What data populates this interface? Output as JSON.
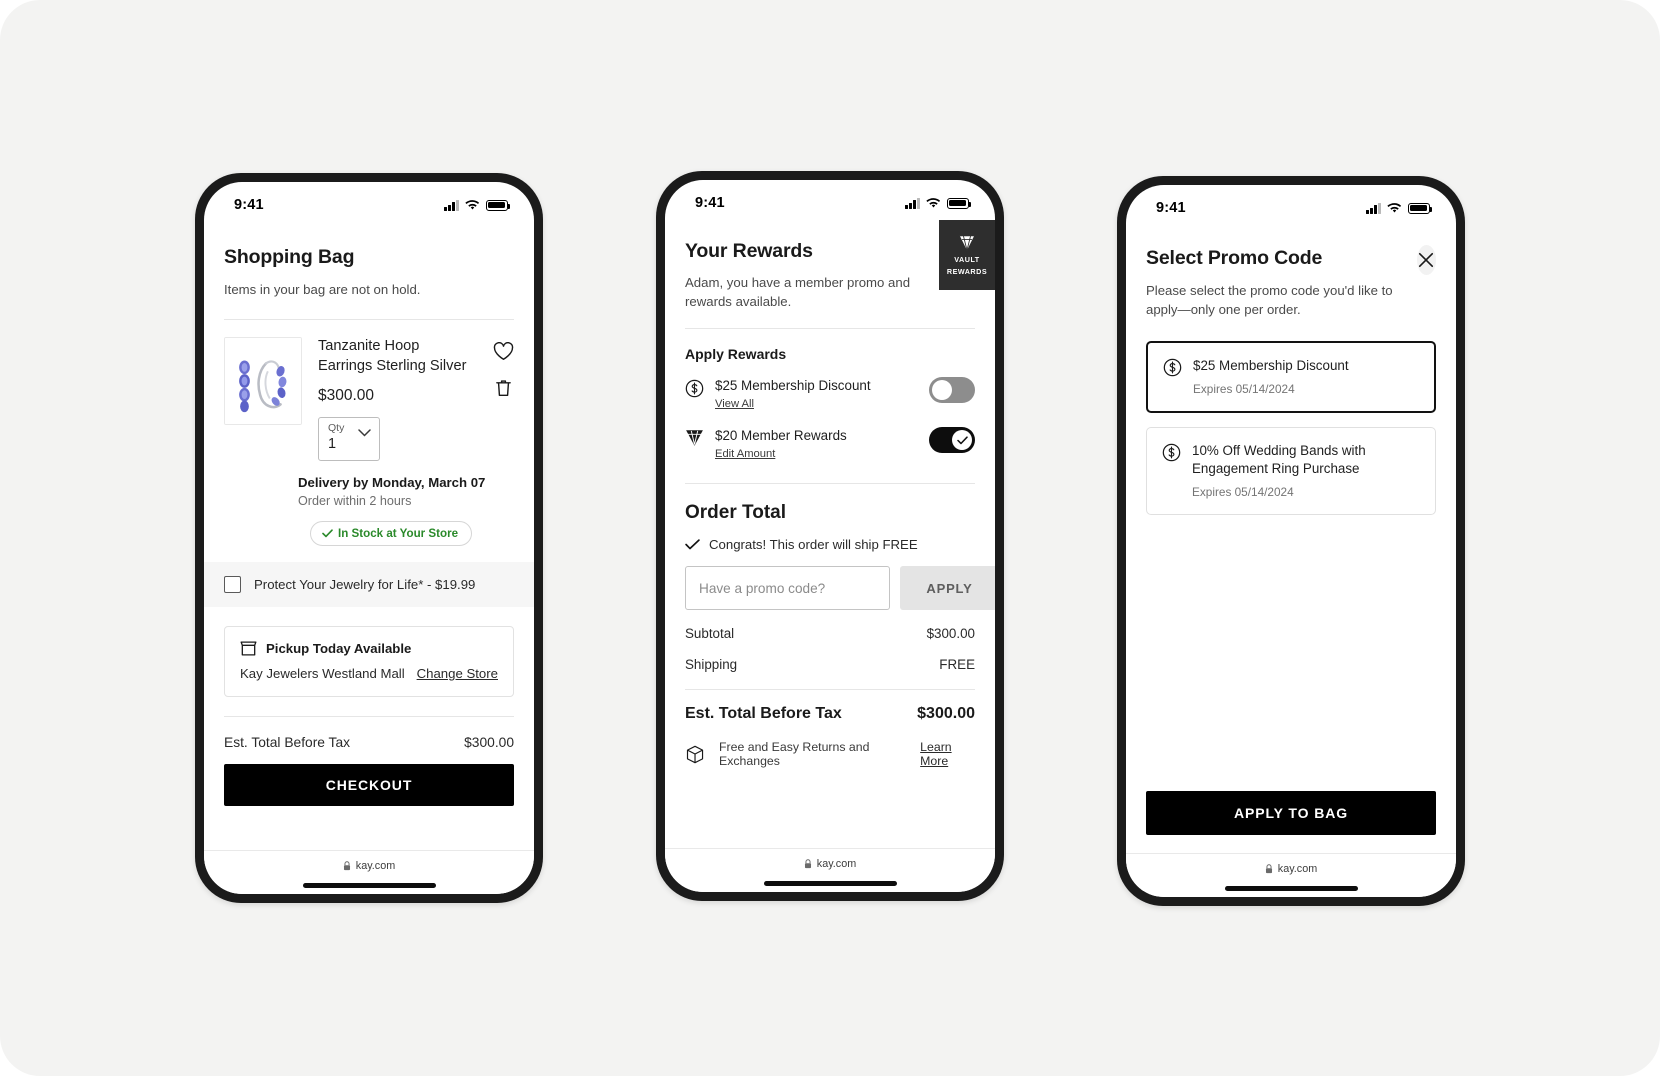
{
  "status_bar": {
    "time": "9:41",
    "signal_icon": "cellular-signal-icon",
    "wifi_icon": "wifi-icon",
    "battery_icon": "battery-icon"
  },
  "browser_footer": {
    "url": "kay.com",
    "lock_icon": "lock-icon"
  },
  "phone1": {
    "title": "Shopping Bag",
    "subtitle": "Items in your bag are not on hold.",
    "product": {
      "image_alt": "tanzanite-hoop-earrings-image",
      "title": "Tanzanite Hoop Earrings Sterling Silver",
      "price": "$300.00",
      "favorite_icon": "heart-icon",
      "delete_icon": "trash-icon",
      "qty_label": "Qty",
      "qty_value": "1",
      "qty_chevron_icon": "chevron-down-icon"
    },
    "delivery": {
      "headline": "Delivery by Monday, March 07",
      "note": "Order within 2 hours",
      "stock_badge": "In Stock at Your Store",
      "stock_check_icon": "check-icon",
      "stock_color": "#2b8a2b"
    },
    "protection": {
      "label": "Protect Your Jewelry for Life* - $19.99",
      "checked": false
    },
    "pickup": {
      "icon": "store-icon",
      "headline": "Pickup Today Available",
      "store": "Kay Jewelers Westland Mall",
      "change_link": "Change Store"
    },
    "total": {
      "label": "Est. Total Before Tax",
      "value": "$300.00"
    },
    "checkout_button": "CHECKOUT"
  },
  "phone2": {
    "title": "Your Rewards",
    "subtitle": "Adam, you have a member promo and rewards available.",
    "badge": {
      "line1": "VAULT",
      "line2": "REWARDS",
      "icon": "diamond-icon",
      "background": "#2e2e2e"
    },
    "apply_rewards_heading": "Apply Rewards",
    "rewards": [
      {
        "icon": "dollar-circle-icon",
        "title": "$25 Membership Discount",
        "link": "View All",
        "enabled": false
      },
      {
        "icon": "diamond-outline-icon",
        "title": "$20 Member Rewards",
        "link": "Edit Amount",
        "enabled": true
      }
    ],
    "order_total_heading": "Order Total",
    "congrats": {
      "icon": "check-icon",
      "text": "Congrats! This order will ship FREE"
    },
    "promo": {
      "placeholder": "Have a promo code?",
      "value": "",
      "apply_button": "APPLY"
    },
    "lines": [
      {
        "label": "Subtotal",
        "value": "$300.00"
      },
      {
        "label": "Shipping",
        "value": "FREE"
      }
    ],
    "grand_total": {
      "label": "Est. Total Before Tax",
      "value": "$300.00"
    },
    "returns": {
      "icon": "box-icon",
      "text": "Free and Easy Returns and Exchanges",
      "link": "Learn More"
    }
  },
  "phone3": {
    "title": "Select Promo Code",
    "close_icon": "close-icon",
    "subtitle": "Please select the promo code you'd like to apply—only one per order.",
    "promo_codes": [
      {
        "icon": "dollar-circle-icon",
        "title": "$25 Membership Discount",
        "expires": "Expires 05/14/2024",
        "selected": true
      },
      {
        "icon": "dollar-circle-icon",
        "title": "10% Off Wedding Bands with Engagement Ring Purchase",
        "expires": "Expires 05/14/2024",
        "selected": false
      }
    ],
    "apply_button": "APPLY TO BAG"
  }
}
